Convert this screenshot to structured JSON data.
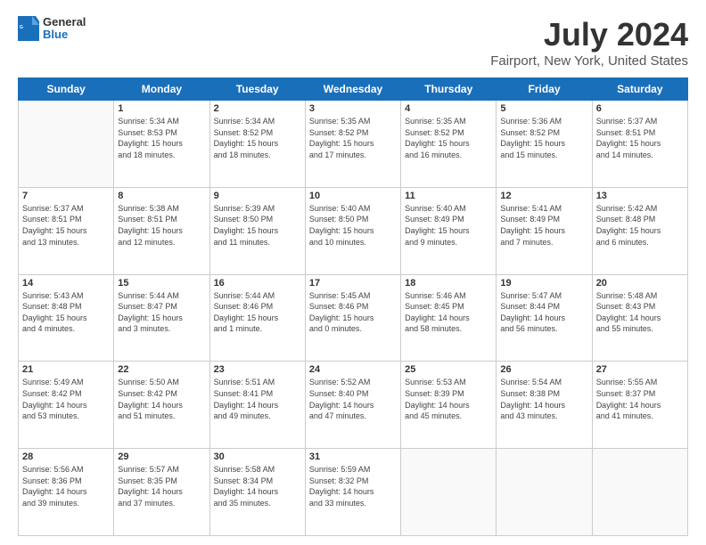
{
  "header": {
    "logo": {
      "general": "General",
      "blue": "Blue"
    },
    "title": "July 2024",
    "subtitle": "Fairport, New York, United States"
  },
  "days": [
    "Sunday",
    "Monday",
    "Tuesday",
    "Wednesday",
    "Thursday",
    "Friday",
    "Saturday"
  ],
  "weeks": [
    [
      {
        "num": "",
        "content": ""
      },
      {
        "num": "1",
        "content": "Sunrise: 5:34 AM\nSunset: 8:53 PM\nDaylight: 15 hours\nand 18 minutes."
      },
      {
        "num": "2",
        "content": "Sunrise: 5:34 AM\nSunset: 8:52 PM\nDaylight: 15 hours\nand 18 minutes."
      },
      {
        "num": "3",
        "content": "Sunrise: 5:35 AM\nSunset: 8:52 PM\nDaylight: 15 hours\nand 17 minutes."
      },
      {
        "num": "4",
        "content": "Sunrise: 5:35 AM\nSunset: 8:52 PM\nDaylight: 15 hours\nand 16 minutes."
      },
      {
        "num": "5",
        "content": "Sunrise: 5:36 AM\nSunset: 8:52 PM\nDaylight: 15 hours\nand 15 minutes."
      },
      {
        "num": "6",
        "content": "Sunrise: 5:37 AM\nSunset: 8:51 PM\nDaylight: 15 hours\nand 14 minutes."
      }
    ],
    [
      {
        "num": "7",
        "content": "Sunrise: 5:37 AM\nSunset: 8:51 PM\nDaylight: 15 hours\nand 13 minutes."
      },
      {
        "num": "8",
        "content": "Sunrise: 5:38 AM\nSunset: 8:51 PM\nDaylight: 15 hours\nand 12 minutes."
      },
      {
        "num": "9",
        "content": "Sunrise: 5:39 AM\nSunset: 8:50 PM\nDaylight: 15 hours\nand 11 minutes."
      },
      {
        "num": "10",
        "content": "Sunrise: 5:40 AM\nSunset: 8:50 PM\nDaylight: 15 hours\nand 10 minutes."
      },
      {
        "num": "11",
        "content": "Sunrise: 5:40 AM\nSunset: 8:49 PM\nDaylight: 15 hours\nand 9 minutes."
      },
      {
        "num": "12",
        "content": "Sunrise: 5:41 AM\nSunset: 8:49 PM\nDaylight: 15 hours\nand 7 minutes."
      },
      {
        "num": "13",
        "content": "Sunrise: 5:42 AM\nSunset: 8:48 PM\nDaylight: 15 hours\nand 6 minutes."
      }
    ],
    [
      {
        "num": "14",
        "content": "Sunrise: 5:43 AM\nSunset: 8:48 PM\nDaylight: 15 hours\nand 4 minutes."
      },
      {
        "num": "15",
        "content": "Sunrise: 5:44 AM\nSunset: 8:47 PM\nDaylight: 15 hours\nand 3 minutes."
      },
      {
        "num": "16",
        "content": "Sunrise: 5:44 AM\nSunset: 8:46 PM\nDaylight: 15 hours\nand 1 minute."
      },
      {
        "num": "17",
        "content": "Sunrise: 5:45 AM\nSunset: 8:46 PM\nDaylight: 15 hours\nand 0 minutes."
      },
      {
        "num": "18",
        "content": "Sunrise: 5:46 AM\nSunset: 8:45 PM\nDaylight: 14 hours\nand 58 minutes."
      },
      {
        "num": "19",
        "content": "Sunrise: 5:47 AM\nSunset: 8:44 PM\nDaylight: 14 hours\nand 56 minutes."
      },
      {
        "num": "20",
        "content": "Sunrise: 5:48 AM\nSunset: 8:43 PM\nDaylight: 14 hours\nand 55 minutes."
      }
    ],
    [
      {
        "num": "21",
        "content": "Sunrise: 5:49 AM\nSunset: 8:42 PM\nDaylight: 14 hours\nand 53 minutes."
      },
      {
        "num": "22",
        "content": "Sunrise: 5:50 AM\nSunset: 8:42 PM\nDaylight: 14 hours\nand 51 minutes."
      },
      {
        "num": "23",
        "content": "Sunrise: 5:51 AM\nSunset: 8:41 PM\nDaylight: 14 hours\nand 49 minutes."
      },
      {
        "num": "24",
        "content": "Sunrise: 5:52 AM\nSunset: 8:40 PM\nDaylight: 14 hours\nand 47 minutes."
      },
      {
        "num": "25",
        "content": "Sunrise: 5:53 AM\nSunset: 8:39 PM\nDaylight: 14 hours\nand 45 minutes."
      },
      {
        "num": "26",
        "content": "Sunrise: 5:54 AM\nSunset: 8:38 PM\nDaylight: 14 hours\nand 43 minutes."
      },
      {
        "num": "27",
        "content": "Sunrise: 5:55 AM\nSunset: 8:37 PM\nDaylight: 14 hours\nand 41 minutes."
      }
    ],
    [
      {
        "num": "28",
        "content": "Sunrise: 5:56 AM\nSunset: 8:36 PM\nDaylight: 14 hours\nand 39 minutes."
      },
      {
        "num": "29",
        "content": "Sunrise: 5:57 AM\nSunset: 8:35 PM\nDaylight: 14 hours\nand 37 minutes."
      },
      {
        "num": "30",
        "content": "Sunrise: 5:58 AM\nSunset: 8:34 PM\nDaylight: 14 hours\nand 35 minutes."
      },
      {
        "num": "31",
        "content": "Sunrise: 5:59 AM\nSunset: 8:32 PM\nDaylight: 14 hours\nand 33 minutes."
      },
      {
        "num": "",
        "content": ""
      },
      {
        "num": "",
        "content": ""
      },
      {
        "num": "",
        "content": ""
      }
    ]
  ]
}
